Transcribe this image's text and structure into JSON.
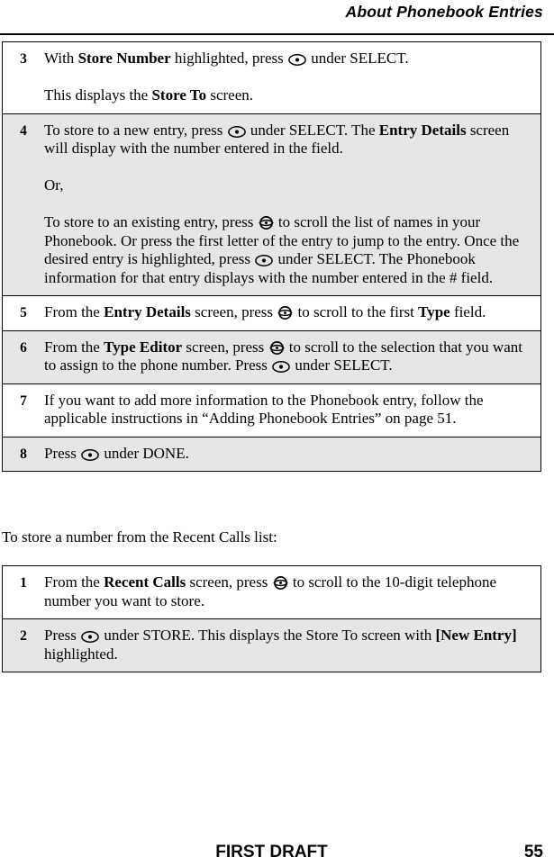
{
  "header": {
    "title": "About Phonebook Entries"
  },
  "icons": {
    "select_key": "select-key-icon",
    "scroll_key": "scroll-navigation-key-icon"
  },
  "table_one": {
    "rows": [
      {
        "number": "3",
        "shaded": false,
        "paragraphs": [
          {
            "parts": [
              {
                "text": "With ",
                "bold": false
              },
              {
                "text": "Store Number",
                "bold": true
              },
              {
                "text": " highlighted, press ",
                "bold": false
              },
              {
                "icon": "select_key"
              },
              {
                "text": " under SELECT.",
                "bold": false
              }
            ]
          },
          {
            "parts": [
              {
                "text": "This displays the ",
                "bold": false
              },
              {
                "text": "Store To",
                "bold": true
              },
              {
                "text": " screen.",
                "bold": false
              }
            ]
          }
        ]
      },
      {
        "number": "4",
        "shaded": true,
        "paragraphs": [
          {
            "parts": [
              {
                "text": "To store to a new entry, press ",
                "bold": false
              },
              {
                "icon": "select_key"
              },
              {
                "text": " under SELECT. The ",
                "bold": false
              },
              {
                "text": "Entry Details",
                "bold": true
              },
              {
                "text": " screen will display with the number entered in the field.",
                "bold": false
              }
            ]
          },
          {
            "parts": [
              {
                "text": "Or,",
                "bold": false
              }
            ]
          },
          {
            "parts": [
              {
                "text": "To store to an existing entry, press ",
                "bold": false
              },
              {
                "icon": "scroll_key"
              },
              {
                "text": " to scroll the list of names in your Phonebook. Or press the first letter of the entry to jump to the entry. Once the desired entry is highlighted, press ",
                "bold": false
              },
              {
                "icon": "select_key"
              },
              {
                "text": " under SELECT. The Phonebook information for that entry displays with the number entered in the # field.",
                "bold": false
              }
            ]
          }
        ]
      },
      {
        "number": "5",
        "shaded": false,
        "paragraphs": [
          {
            "parts": [
              {
                "text": "From the ",
                "bold": false
              },
              {
                "text": "Entry Details",
                "bold": true
              },
              {
                "text": " screen, press ",
                "bold": false
              },
              {
                "icon": "scroll_key"
              },
              {
                "text": " to scroll to the first ",
                "bold": false
              },
              {
                "text": "Type",
                "bold": true
              },
              {
                "text": " field.",
                "bold": false
              }
            ]
          }
        ]
      },
      {
        "number": "6",
        "shaded": true,
        "paragraphs": [
          {
            "parts": [
              {
                "text": "From the ",
                "bold": false
              },
              {
                "text": "Type Editor",
                "bold": true
              },
              {
                "text": " screen, press ",
                "bold": false
              },
              {
                "icon": "scroll_key"
              },
              {
                "text": " to scroll to the selection that you want to assign to the phone number. Press ",
                "bold": false
              },
              {
                "icon": "select_key"
              },
              {
                "text": " under SELECT.",
                "bold": false
              }
            ]
          }
        ]
      },
      {
        "number": "7",
        "shaded": false,
        "paragraphs": [
          {
            "parts": [
              {
                "text": "If you want to add more information to the Phonebook entry, follow the applicable instructions in “Adding Phonebook Entries” on page 51.",
                "bold": false
              }
            ]
          }
        ]
      },
      {
        "number": "8",
        "shaded": true,
        "paragraphs": [
          {
            "parts": [
              {
                "text": "Press ",
                "bold": false
              },
              {
                "icon": "select_key"
              },
              {
                "text": " under DONE.",
                "bold": false
              }
            ]
          }
        ]
      }
    ]
  },
  "lead_text": "To store a number from the Recent Calls list:",
  "table_two": {
    "rows": [
      {
        "number": "1",
        "shaded": false,
        "paragraphs": [
          {
            "parts": [
              {
                "text": "From the ",
                "bold": false
              },
              {
                "text": "Recent Calls",
                "bold": true
              },
              {
                "text": " screen, press ",
                "bold": false
              },
              {
                "icon": "scroll_key"
              },
              {
                "text": " to scroll to the 10-digit telephone number you want to store.",
                "bold": false
              }
            ]
          }
        ]
      },
      {
        "number": "2",
        "shaded": true,
        "paragraphs": [
          {
            "parts": [
              {
                "text": "Press ",
                "bold": false
              },
              {
                "icon": "select_key"
              },
              {
                "text": " under STORE. This displays the Store To screen with ",
                "bold": false
              },
              {
                "text": "[New Entry]",
                "bold": true
              },
              {
                "text": " highlighted.",
                "bold": false
              }
            ]
          }
        ]
      }
    ]
  },
  "footer": {
    "label": "FIRST DRAFT",
    "page_number": "55"
  },
  "colors": {
    "page_background": "#ffffff",
    "text": "#000000",
    "shaded_row": "#e6e6e6",
    "rule": "#000000"
  }
}
